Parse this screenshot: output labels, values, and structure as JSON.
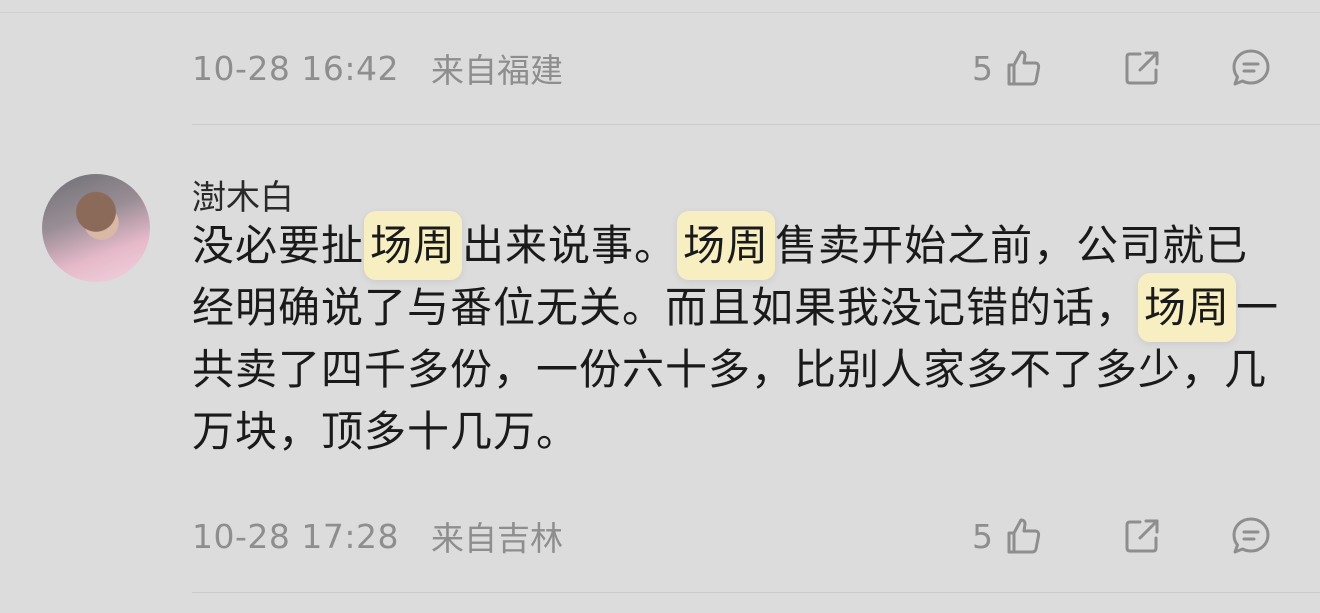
{
  "comment1": {
    "time": "10-28 16:42",
    "location": "来自福建",
    "likes": "5"
  },
  "comment2": {
    "username": "澍木白",
    "text_parts": [
      "没必要扯",
      "场周",
      "出来说事。",
      "场周",
      "售卖开始之前，公司就已经明确说了与番位无关。而且如果我没记错的话，",
      "场周",
      "一共卖了四千多份，一份六十多，比别人家多不了多少，几万块，顶多十几万。"
    ],
    "time": "10-28 17:28",
    "location": "来自吉林",
    "likes": "5"
  },
  "icons": [
    "thumbs-up-icon",
    "share-icon",
    "comment-icon"
  ],
  "colors": {
    "background": "#dcdcdc",
    "meta_text": "#8e8e8e",
    "highlight": "#f7efc2"
  }
}
